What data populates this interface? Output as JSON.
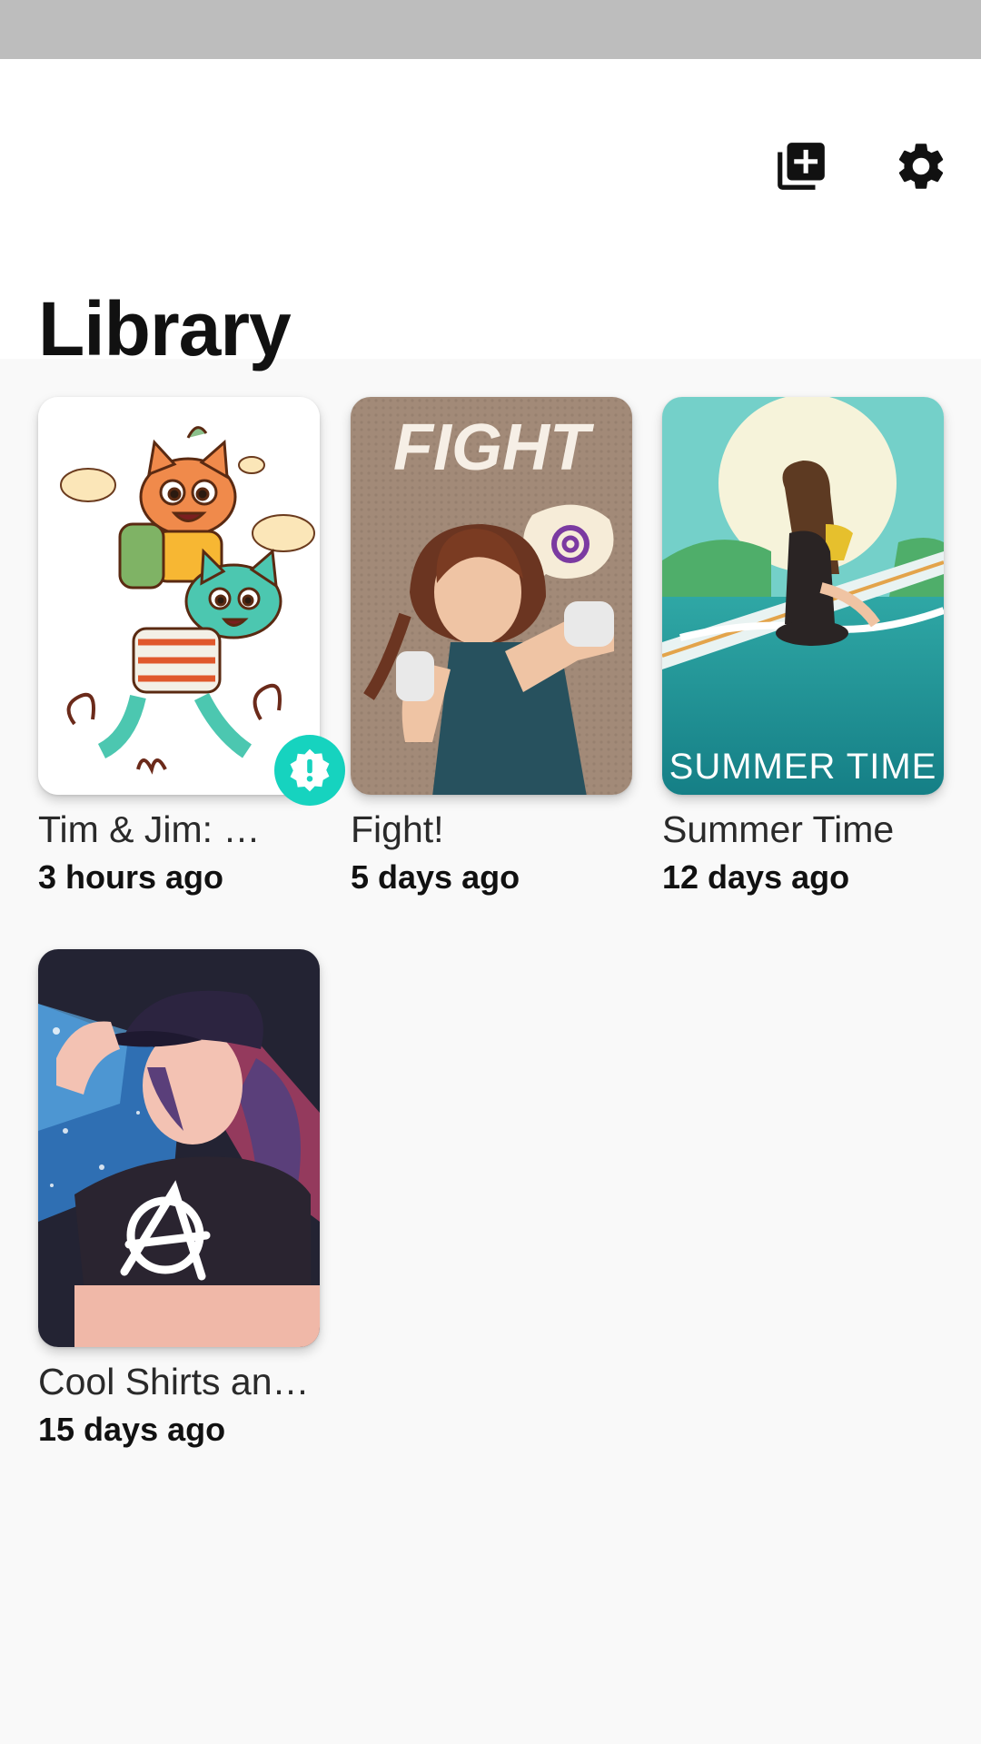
{
  "header": {
    "title": "Library",
    "add_icon": "library-add-icon",
    "settings_icon": "gear-icon"
  },
  "colors": {
    "accent": "#16d3bf",
    "background": "#f9f9f9",
    "status_bar": "#bdbdbd"
  },
  "library": {
    "items": [
      {
        "title": "Tim & Jim: …",
        "time": "3 hours ago",
        "has_alert": true
      },
      {
        "title": "Fight!",
        "time": "5 days ago",
        "cover_text": "FIGHT"
      },
      {
        "title": "Summer Time",
        "time": "12 days ago",
        "cover_text": "SUMMER TIME"
      },
      {
        "title": "Cool Shirts an…",
        "time": "15 days ago"
      }
    ]
  }
}
